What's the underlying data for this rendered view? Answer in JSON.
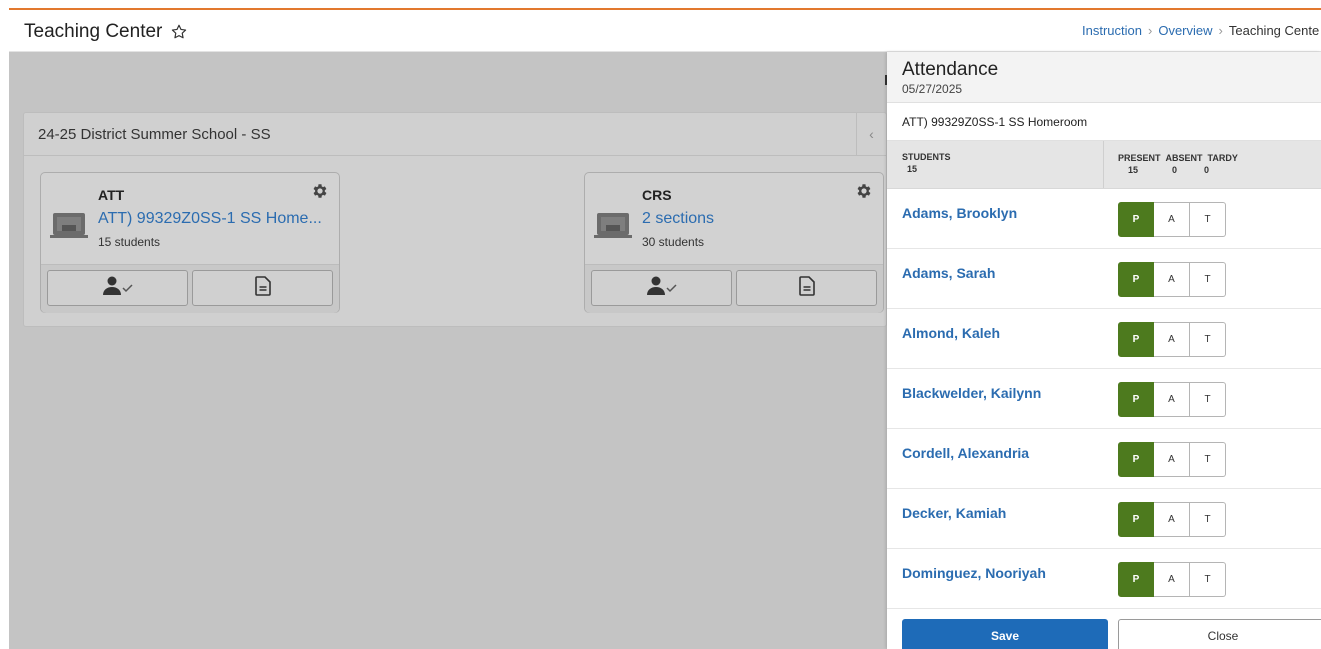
{
  "header": {
    "title": "Teaching Center",
    "breadcrumb": {
      "item1": "Instruction",
      "item2": "Overview",
      "current": "Teaching Cente"
    }
  },
  "school": {
    "name": "24-25 District Summer School - SS",
    "cards": [
      {
        "code": "ATT",
        "link": "ATT) 99329Z0SS-1 SS Home...",
        "sub": "15 students"
      },
      {
        "code": "CRS",
        "link": "2 sections",
        "sub": "30 students"
      }
    ]
  },
  "attendance": {
    "title": "Attendance",
    "date": "05/27/2025",
    "section": "ATT) 99329Z0SS-1 SS Homeroom",
    "columns": {
      "students_label": "STUDENTS",
      "students_count": "15",
      "present_label": "PRESENT",
      "absent_label": "ABSENT",
      "tardy_label": "TARDY",
      "present_count": "15",
      "absent_count": "0",
      "tardy_count": "0"
    },
    "buttons": {
      "p": "P",
      "a": "A",
      "t": "T"
    },
    "students": [
      {
        "name": "Adams, Brooklyn"
      },
      {
        "name": "Adams, Sarah"
      },
      {
        "name": "Almond, Kaleh"
      },
      {
        "name": "Blackwelder, Kailynn"
      },
      {
        "name": "Cordell, Alexandria"
      },
      {
        "name": "Decker, Kamiah"
      },
      {
        "name": "Dominguez, Nooriyah"
      }
    ],
    "save_label": "Save",
    "close_label": "Close"
  },
  "colors": {
    "accent_orange": "#e2782e",
    "link_blue": "#2b6cb0",
    "present_green": "#4d7a1e",
    "save_blue": "#1e6bb8"
  }
}
